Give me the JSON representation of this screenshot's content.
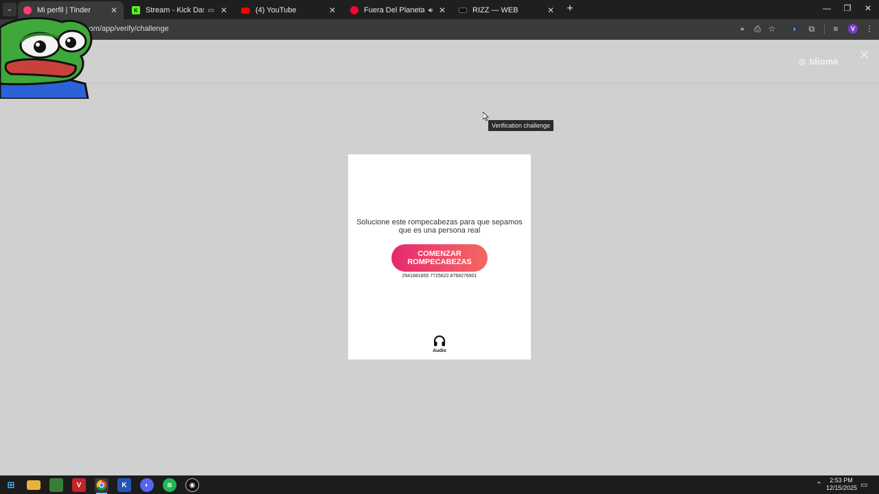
{
  "browser": {
    "tabs": [
      {
        "title": "Mi perfil | Tinder",
        "active": true,
        "favicon_color": "#fe3c72",
        "favicon_icon": "tinder-flame-icon"
      },
      {
        "title": "Stream - Kick Dashboard",
        "active": false,
        "favicon_color": "#53fc18",
        "favicon_icon": "kick-icon",
        "extra": "cast-icon"
      },
      {
        "title": "(4) YouTube",
        "active": false,
        "favicon_color": "#ff0000",
        "favicon_icon": "youtube-icon"
      },
      {
        "title": "Fuera Del Planeta - YouTube",
        "active": false,
        "favicon_color": "#ff0033",
        "favicon_icon": "youtube-music-icon",
        "extra": "speaker-icon"
      },
      {
        "title": "RIZZ — WEB",
        "active": false,
        "favicon_color": "#111111",
        "favicon_icon": "rizz-icon"
      }
    ],
    "address": "r.com/app/verify/challenge",
    "profile_initial": "V"
  },
  "page": {
    "language_label": "Idioma",
    "tooltip": "Verification challenge",
    "card": {
      "message": "Solucione este rompecabezas para que sepamos que es una persona real",
      "button_label": "COMENZAR ROMPECABEZAS",
      "session_code": "2941881855 7725622.8768276901",
      "audio_label": "Audio"
    }
  },
  "taskbar": {
    "time": "2:53 PM",
    "date": "12/15/2025"
  },
  "colors": {
    "accent_start": "#e6286f",
    "accent_end": "#f3675f",
    "page_bg": "#cfd0cf"
  }
}
